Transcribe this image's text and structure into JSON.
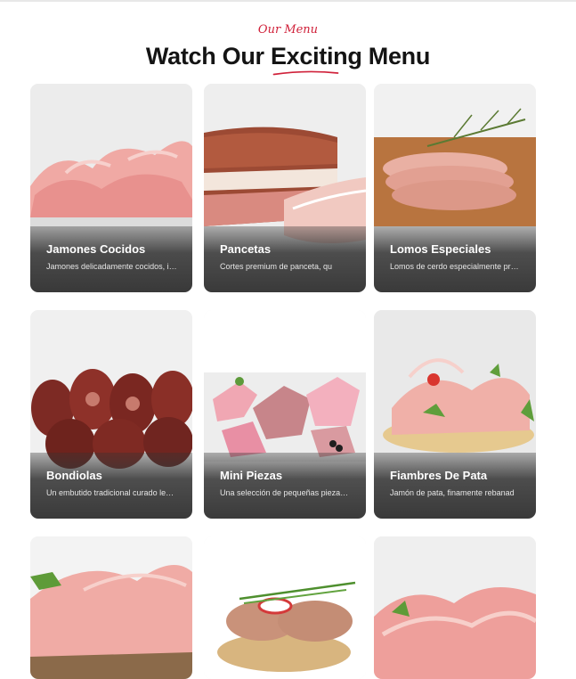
{
  "section": {
    "eyebrow": "Our Menu",
    "title_before": "Watch Our",
    "title_highlight": "Exciting",
    "title_after": "Menu",
    "accent_color": "#d0213a"
  },
  "cards": [
    {
      "title": "Jamones Cocidos",
      "description": "Jamones delicadamente cocidos, ideales"
    },
    {
      "title": "Pancetas",
      "description": "Cortes premium de panceta, qu"
    },
    {
      "title": "Lomos Especiales",
      "description": "Lomos de cerdo especialmente preparados"
    },
    {
      "title": "Bondiolas",
      "description": "Un embutido tradicional curado lentamente"
    },
    {
      "title": "Mini Piezas",
      "description": "Una selección de pequeñas piezas surtidas"
    },
    {
      "title": "Fiambres De Pata",
      "description": "Jamón de pata, finamente rebanad"
    }
  ]
}
